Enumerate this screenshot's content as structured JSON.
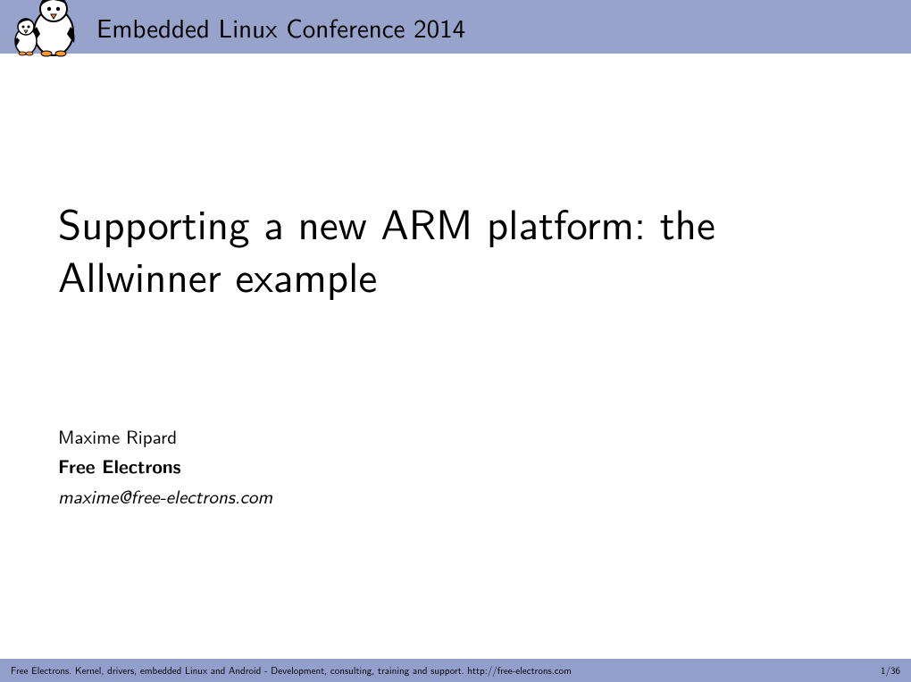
{
  "header": {
    "title": "Embedded Linux Conference 2014"
  },
  "main": {
    "title": "Supporting a new ARM platform: the Allwinner example",
    "author": "Maxime Ripard",
    "organization": "Free Electrons",
    "email": "maxime@free-electrons.com"
  },
  "footer": {
    "text": "Free Electrons. Kernel, drivers, embedded Linux and Android - Development, consulting, training and support. http://free-electrons.com",
    "page": "1/36"
  }
}
